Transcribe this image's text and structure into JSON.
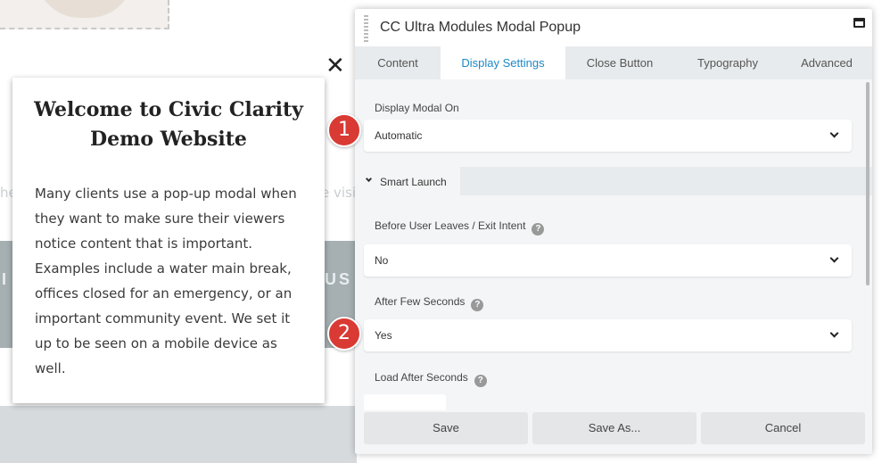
{
  "background": {
    "band_text_left": "I",
    "band_text_right": "US",
    "faint_text_left": "he",
    "faint_text_right": "e visi"
  },
  "demo_modal": {
    "close_glyph": "✕",
    "title": "Welcome to Civic Clarity Demo Website",
    "body": "Many clients use a pop-up modal when they want to make sure their viewers notice content that is important.  Examples include a water main break, offices closed for an emergency, or an important community event.  We set it up to be seen on a mobile device as well."
  },
  "panel": {
    "title": "CC Ultra Modules Modal Popup",
    "tabs": [
      {
        "label": "Content"
      },
      {
        "label": "Display Settings"
      },
      {
        "label": "Close Button"
      },
      {
        "label": "Typography"
      },
      {
        "label": "Advanced"
      }
    ],
    "active_tab": "Display Settings",
    "fields": {
      "display_modal_on": {
        "label": "Display Modal On",
        "value": "Automatic"
      },
      "exit_intent": {
        "label": "Before User Leaves / Exit Intent",
        "value": "No"
      },
      "after_few_seconds": {
        "label": "After Few Seconds",
        "value": "Yes"
      },
      "load_after_seconds": {
        "label": "Load After Seconds",
        "value": ""
      }
    },
    "section": {
      "label": "Smart Launch"
    },
    "help_glyph": "?",
    "buttons": {
      "save": "Save",
      "save_as": "Save As...",
      "cancel": "Cancel"
    }
  },
  "markers": [
    "1",
    "2"
  ],
  "colors": {
    "accent": "#1d89c7",
    "marker": "#d93a34",
    "tab_bar": "#e8ebed"
  }
}
